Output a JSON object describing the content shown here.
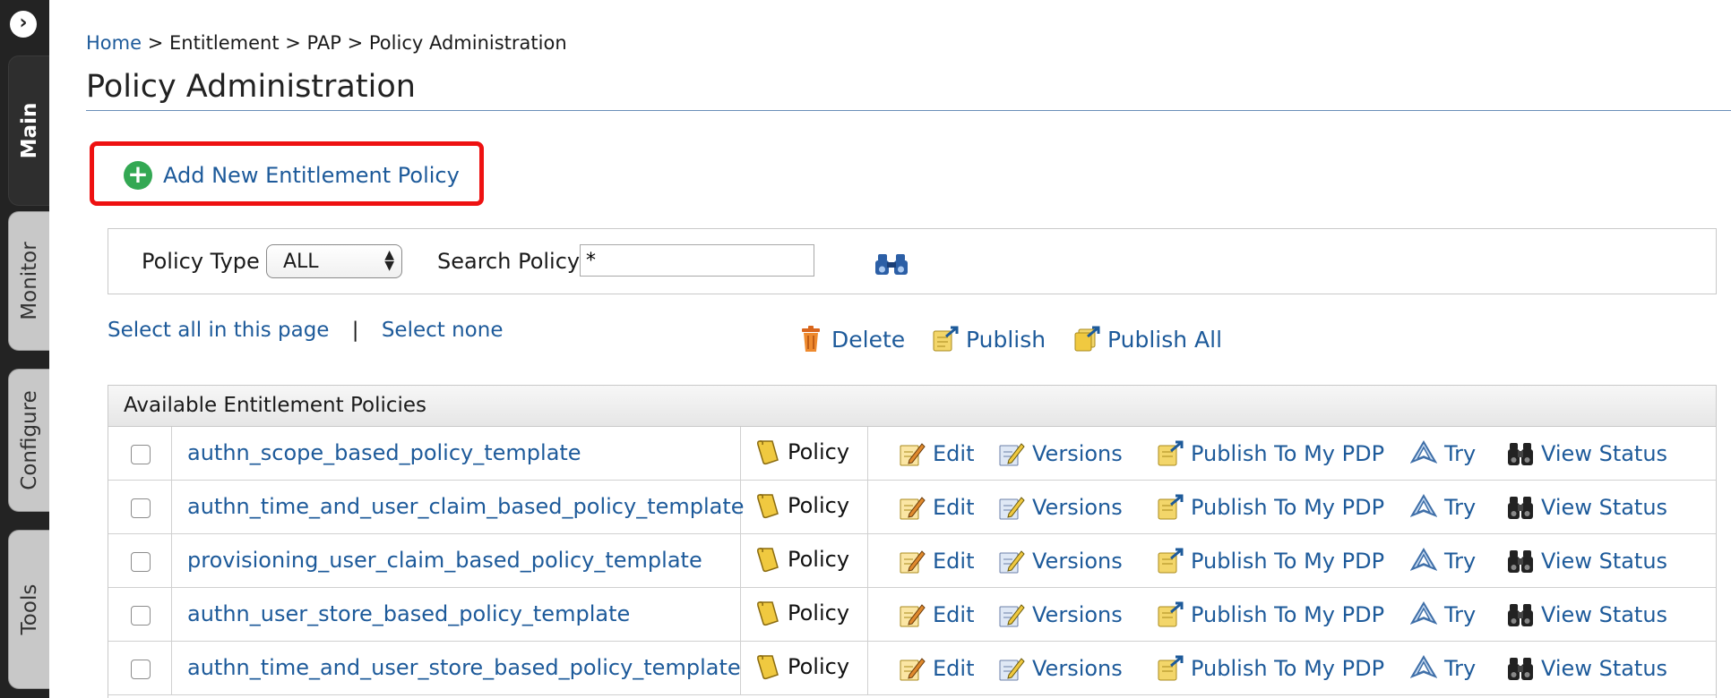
{
  "sidebar": {
    "toggle_icon": "chevron-right-circle-icon",
    "tabs": [
      {
        "label": "Main",
        "active": true
      },
      {
        "label": "Monitor",
        "active": false
      },
      {
        "label": "Configure",
        "active": false
      },
      {
        "label": "Tools",
        "active": false
      }
    ]
  },
  "breadcrumb": {
    "home": "Home",
    "separator": ">",
    "entitlement": "Entitlement",
    "pap": "PAP",
    "current": "Policy Administration"
  },
  "page_title": "Policy Administration",
  "add_policy": {
    "label": "Add New Entitlement Policy",
    "icon": "add-circle-icon",
    "highlight_color": "#ee1111"
  },
  "search": {
    "policy_type_label": "Policy Type",
    "policy_type_value": "ALL",
    "search_label": "Search Policy",
    "search_value": "*",
    "search_icon": "binoculars-icon"
  },
  "selection": {
    "select_all": "Select all in this page",
    "separator": "|",
    "select_none": "Select none"
  },
  "bulk_actions": {
    "delete": "Delete",
    "publish": "Publish",
    "publish_all": "Publish All"
  },
  "table": {
    "header": "Available Entitlement Policies",
    "rows": [
      {
        "name": "authn_scope_based_policy_template",
        "type": "Policy"
      },
      {
        "name": "authn_time_and_user_claim_based_policy_template",
        "type": "Policy"
      },
      {
        "name": "provisioning_user_claim_based_policy_template",
        "type": "Policy"
      },
      {
        "name": "authn_user_store_based_policy_template",
        "type": "Policy"
      },
      {
        "name": "authn_time_and_user_store_based_policy_template",
        "type": "Policy"
      }
    ],
    "row_actions": {
      "edit": "Edit",
      "versions": "Versions",
      "publish_to_pdp": "Publish To My PDP",
      "try": "Try",
      "view_status": "View Status"
    }
  },
  "colors": {
    "link": "#1d5a9a",
    "sidebar": "#232323",
    "add_icon": "#33a853"
  }
}
